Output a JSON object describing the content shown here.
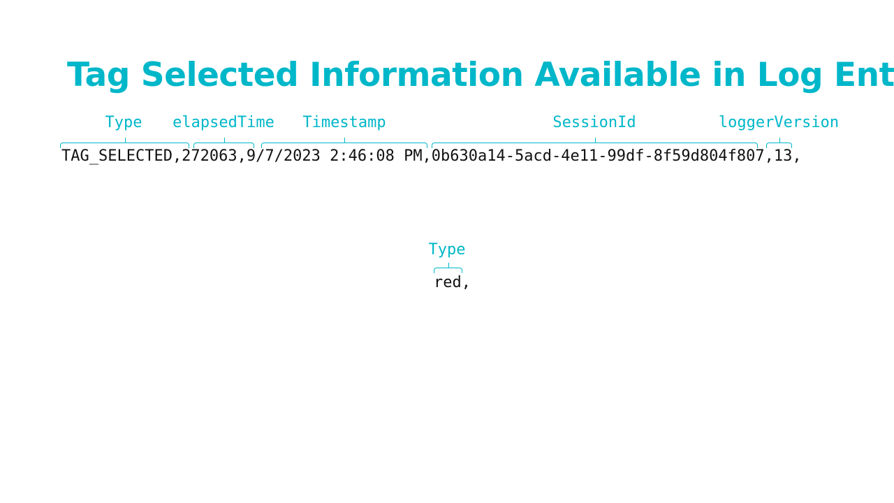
{
  "title": "Tag Selected Information Available in Log Entry",
  "log_entry_1": {
    "text": "TAG_SELECTED,272063,9/7/2023 2:46:08 PM,0b630a14-5acd-4e11-99df-8f59d804f807,13,",
    "fields": [
      {
        "label": "Type",
        "value": "TAG_SELECTED"
      },
      {
        "label": "elapsedTime",
        "value": "272063"
      },
      {
        "label": "Timestamp",
        "value": "9/7/2023 2:46:08 PM"
      },
      {
        "label": "SessionId",
        "value": "0b630a14-5acd-4e11-99df-8f59d804f807"
      },
      {
        "label": "loggerVersion",
        "value": "13"
      }
    ]
  },
  "log_entry_2": {
    "text": "red,",
    "fields": [
      {
        "label": "Type",
        "value": "red"
      }
    ]
  },
  "colors": {
    "accent": "#00b7c9",
    "text": "#111111",
    "background": "#ffffff"
  }
}
